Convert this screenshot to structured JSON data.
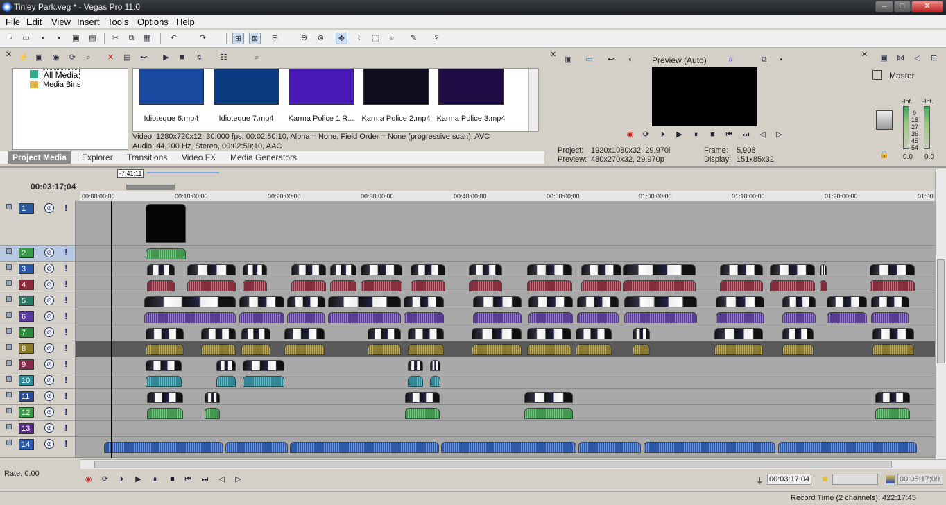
{
  "window": {
    "title": "Tinley Park.veg * - Vegas Pro 11.0",
    "min": "‒",
    "max": "□",
    "close": "✕"
  },
  "menu": [
    "File",
    "Edit",
    "View",
    "Insert",
    "Tools",
    "Options",
    "Help"
  ],
  "explorer": {
    "tree": [
      "All Media",
      "Media Bins"
    ],
    "media": [
      {
        "name": "Idioteque 6.mp4",
        "color": "#2a6fd0"
      },
      {
        "name": "Idioteque 7.mp4",
        "color": "#1a5fa8"
      },
      {
        "name": "Karma Police 1 R...",
        "color": "#5a22c8"
      },
      {
        "name": "Karma Police 2.mp4",
        "color": "#1a1230"
      },
      {
        "name": "Karma Police 3.mp4",
        "color": "#2a1258"
      }
    ],
    "info_line1": "Video: 1280x720x12, 30.000 fps, 00:02:50;10, Alpha = None, Field Order = None (progressive scan), AVC",
    "info_line2": "Audio: 44,100 Hz, Stereo, 00:02:50;10, AAC",
    "tabs": [
      "Project Media",
      "Explorer",
      "Transitions",
      "Video FX",
      "Media Generators"
    ]
  },
  "preview": {
    "mode": "Preview (Auto)",
    "project_label": "Project:",
    "project_value": "1920x1080x32, 29.970i",
    "preview_label": "Preview:",
    "preview_value": "480x270x32, 29.970p",
    "frame_label": "Frame:",
    "frame_value": "5,908",
    "display_label": "Display:",
    "display_value": "151x85x32"
  },
  "mixer": {
    "label": "Master",
    "left_peak": "-Inf.",
    "right_peak": "-Inf.",
    "scale": [
      "9",
      "18",
      "27",
      "36",
      "45",
      "54"
    ],
    "left_val": "0.0",
    "right_val": "0.0"
  },
  "timeline": {
    "cursor_time": "00:03:17;04",
    "loop_badge": "-7:41;11",
    "ruler": [
      "00:00:00;00",
      "00:10:00;00",
      "00:20:00;00",
      "00:30:00;00",
      "00:40:00;00",
      "00:50:00;00",
      "01:00:00;00",
      "01:10:00;00",
      "01:20:00;00",
      "01:30"
    ],
    "tracks": [
      {
        "num": "1",
        "color": "#2c5aa0"
      },
      {
        "num": "2",
        "color": "#3a9a4a"
      },
      {
        "num": "3",
        "color": "#2a56a8"
      },
      {
        "num": "4",
        "color": "#8a2a3a"
      },
      {
        "num": "5",
        "color": "#2a7a6a"
      },
      {
        "num": "6",
        "color": "#5a3a9a"
      },
      {
        "num": "7",
        "color": "#2a8a3a"
      },
      {
        "num": "8",
        "color": "#8a7a2a"
      },
      {
        "num": "9",
        "color": "#8a2a4a"
      },
      {
        "num": "10",
        "color": "#2a8a9a"
      },
      {
        "num": "11",
        "color": "#2a4a9a"
      },
      {
        "num": "12",
        "color": "#3a9a4a"
      },
      {
        "num": "13",
        "color": "#5a2a8a"
      },
      {
        "num": "14",
        "color": "#2a5ab0"
      }
    ]
  },
  "status": {
    "rate": "Rate: 0.00",
    "transport_time": "00:03:17;04",
    "end_time": "00:05:17;09",
    "record": "Record Time (2 channels): 422:17:45"
  },
  "colors": {
    "accent": "#3a6ea5",
    "track_active": "#5a5a5a",
    "timeline_bg": "#a8a8a8"
  }
}
